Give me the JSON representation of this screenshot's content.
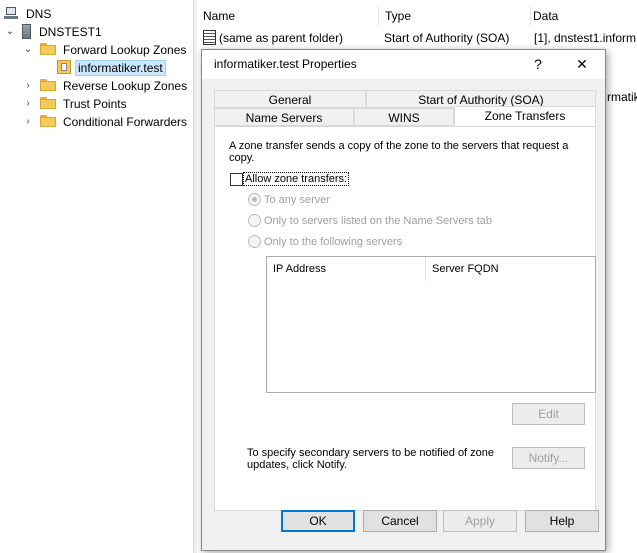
{
  "tree": {
    "root": "DNS",
    "server": "DNSTEST1",
    "forward_zones": "Forward Lookup Zones",
    "zone": "informatiker.test",
    "reverse_zones": "Reverse Lookup Zones",
    "trust_points": "Trust Points",
    "conditional_forwarders": "Conditional Forwarders"
  },
  "list": {
    "columns": [
      "Name",
      "Type",
      "Data"
    ],
    "rows": [
      {
        "name": "(same as parent folder)",
        "type": "Start of Authority (SOA)",
        "data": "[1], dnstest1.inform"
      },
      {
        "name": "",
        "type": "",
        "data": "rmatik"
      }
    ]
  },
  "dialog": {
    "title": "informatiker.test Properties",
    "help_glyph": "?",
    "close_glyph": "✕",
    "tabs_back": [
      "General",
      "Start of Authority (SOA)"
    ],
    "tabs_front": [
      "Name Servers",
      "WINS",
      "Zone Transfers"
    ],
    "active_tab": "Zone Transfers",
    "description": "A zone transfer sends a copy of the zone to the servers that request a copy.",
    "allow_label": "Allow zone transfers:",
    "allow_checked": false,
    "radio_options": [
      "To any server",
      "Only to servers listed on the Name Servers tab",
      "Only to the following servers"
    ],
    "ip_columns": [
      "IP Address",
      "Server FQDN"
    ],
    "edit_label": "Edit",
    "notify_text": "To specify secondary servers to be notified of zone updates, click Notify.",
    "notify_label": "Notify...",
    "buttons": {
      "ok": "OK",
      "cancel": "Cancel",
      "apply": "Apply",
      "help": "Help"
    }
  }
}
